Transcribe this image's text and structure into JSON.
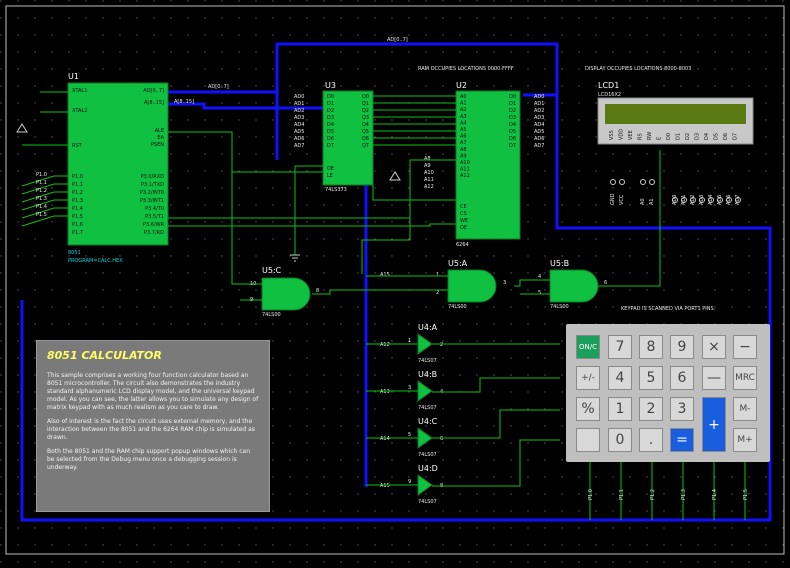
{
  "top_notes": {
    "ram_note": "RAM OCCUPIES LOCATIONS 0000-FFFF",
    "display_note": "DISPLAY OCCUPIES LOCATIONS 8000-8003",
    "keypad_note": "KEYPAD IS SCANNED VIA PORT1 PINS."
  },
  "bus_label": "AD[0..7]",
  "u1": {
    "ref": "U1",
    "part": "8051",
    "program": "PROGRAM=CALC.HEX",
    "left_pins": [
      "XTAL1",
      "XTAL2",
      "RST",
      "P1.0",
      "P1.1",
      "P1.2",
      "P1.3",
      "P1.4",
      "P1.5",
      "P1.6",
      "P1.7"
    ],
    "right_pins": [
      "AD[0..7]",
      "A[8..15]",
      "ALE",
      "EA",
      "PSEN",
      "P3.0/RXD",
      "P3.1/TXD",
      "P3.2/INT0",
      "P3.3/INT1",
      "P3.4/T0",
      "P3.5/T1",
      "P3.6/WR",
      "P3.7/RD"
    ],
    "ext_left": [
      "P1.0",
      "P1.1",
      "P1.2",
      "P1.3",
      "P1.4",
      "P1.5"
    ],
    "bus_ad": "AD[0..7]",
    "bus_a": "A[8..15]"
  },
  "u3": {
    "ref": "U3",
    "part": "74LS373",
    "left_pins": [
      "D0",
      "D1",
      "D2",
      "D3",
      "D4",
      "D5",
      "D6",
      "D7",
      "OE",
      "LE"
    ],
    "right_pins": [
      "Q0",
      "Q1",
      "Q2",
      "Q3",
      "Q4",
      "Q5",
      "Q6",
      "Q7"
    ],
    "ext_left": [
      "AD0",
      "AD1",
      "AD2",
      "AD3",
      "AD4",
      "AD5",
      "AD6",
      "AD7"
    ]
  },
  "u2": {
    "ref": "U2",
    "part": "6264",
    "left_pins": [
      "A0",
      "A1",
      "A2",
      "A3",
      "A4",
      "A5",
      "A6",
      "A7",
      "A8",
      "A9",
      "A10",
      "A11",
      "A12",
      "CE",
      "CS",
      "WE",
      "OE"
    ],
    "right_pins": [
      "D0",
      "D1",
      "D2",
      "D3",
      "D4",
      "D5",
      "D6",
      "D7"
    ],
    "ext_left": [
      "A8",
      "A9",
      "A10",
      "A11",
      "A12"
    ],
    "ext_right": [
      "AD0",
      "AD1",
      "AD2",
      "AD3",
      "AD4",
      "AD5",
      "AD6",
      "AD7"
    ]
  },
  "lcd": {
    "ref": "LCD1",
    "part": "LCD16X2",
    "pins": [
      "VSS",
      "VDD",
      "VEE",
      "RS",
      "RW",
      "E",
      "D0",
      "D1",
      "D2",
      "D3",
      "D4",
      "D5",
      "D6",
      "D7"
    ],
    "net_labels": [
      "GND",
      "VCC",
      "A0",
      "A1",
      "AD0",
      "AD1",
      "AD2",
      "AD3",
      "AD4",
      "AD5",
      "AD6",
      "AD7"
    ]
  },
  "gates": {
    "u5c": {
      "ref": "U5:C",
      "part": "74LS00",
      "pin_in1": "10",
      "pin_in2": "9",
      "pin_out": "8"
    },
    "u5a": {
      "ref": "U5:A",
      "part": "74LS00",
      "pin_in1": "1",
      "pin_in2": "2",
      "pin_out": "3",
      "net": "A15"
    },
    "u5b": {
      "ref": "U5:B",
      "part": "74LS00",
      "pin_in1": "4",
      "pin_in2": "5",
      "pin_out": "6"
    },
    "u4a": {
      "ref": "U4:A",
      "part": "74LS07",
      "net": "A12",
      "pin_in": "1",
      "pin_out": "2"
    },
    "u4b": {
      "ref": "U4:B",
      "part": "74LS07",
      "net": "A13",
      "pin_in": "3",
      "pin_out": "4"
    },
    "u4c": {
      "ref": "U4:C",
      "part": "74LS07",
      "net": "A14",
      "pin_in": "5",
      "pin_out": "6"
    },
    "u4d": {
      "ref": "U4:D",
      "part": "74LS07",
      "net": "A15",
      "pin_in": "9",
      "pin_out": "8"
    }
  },
  "info": {
    "title": "8051 CALCULATOR",
    "p1": "This sample comprises a working four function calculator based an 8051 microcontroller. The circuit also demonstrates the industry standard alphanumeric LCD display model, and the universal keypad model. As you can see, the latter allows you to simulate any design of matrix keypad with as much realism as you care to draw.",
    "p2": "Also of interest is the fact the circuit uses external memory, and the interaction between the 8051 and the 6264 RAM chip is simulated as drawn.",
    "p3": "Both the 8051 and the RAM chip support popup windows which can be selected from the Debug menu once a debugging session is underway."
  },
  "keypad": {
    "row_a": [
      "ON/C",
      "7",
      "8",
      "9",
      "×",
      "−"
    ],
    "row_b": [
      "+/-",
      "4",
      "5",
      "6",
      "—",
      "MRC"
    ],
    "row_c": [
      "%",
      "1",
      "2",
      "3",
      "+",
      "M-"
    ],
    "row_d": [
      "",
      "0",
      ".",
      "=",
      "M+"
    ],
    "port_labels": [
      "P1.0",
      "P1.1",
      "P1.2",
      "P1.3",
      "P1.4",
      "P1.5"
    ]
  },
  "colors": {
    "chip": "#10c040",
    "wire": "#10c010",
    "bus": "#1010ff",
    "lcd_screen": "#5a7a14",
    "panel": "#7a7a7a"
  }
}
